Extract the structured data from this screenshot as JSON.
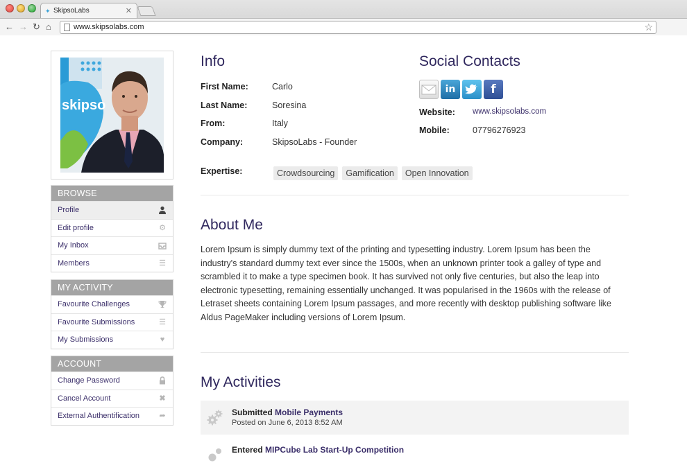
{
  "browser": {
    "tab_title": "SkipsoLabs",
    "url": "www.skipsolabs.com"
  },
  "sidebar": {
    "sections": [
      {
        "title": "BROWSE",
        "items": [
          {
            "label": "Profile",
            "icon": "user-icon"
          },
          {
            "label": "Edit profile",
            "icon": "gear-icon"
          },
          {
            "label": "My Inbox",
            "icon": "inbox-icon"
          },
          {
            "label": "Members",
            "icon": "list-icon"
          }
        ]
      },
      {
        "title": "MY ACTIVITY",
        "items": [
          {
            "label": "Favourite Challenges",
            "icon": "trophy-icon"
          },
          {
            "label": "Favourite Submissions",
            "icon": "list-icon"
          },
          {
            "label": "My Submissions",
            "icon": "heart-icon"
          }
        ]
      },
      {
        "title": "ACCOUNT",
        "items": [
          {
            "label": "Change Password",
            "icon": "lock-icon"
          },
          {
            "label": "Cancel Account",
            "icon": "x-icon"
          },
          {
            "label": "External Authentification",
            "icon": "arrow-icon"
          }
        ]
      }
    ]
  },
  "photo": {
    "banner_text": "skipso"
  },
  "info": {
    "heading": "Info",
    "first_name_label": "First Name:",
    "first_name": "Carlo",
    "last_name_label": "Last Name:",
    "last_name": "Soresina",
    "from_label": "From:",
    "from": "Italy",
    "company_label": "Company:",
    "company": "SkipsoLabs - Founder",
    "expertise_label": "Expertise:",
    "expertise": [
      "Crowdsourcing",
      "Gamification",
      "Open Innovation"
    ]
  },
  "social": {
    "heading": "Social Contacts",
    "icons": [
      "email-icon",
      "linkedin-icon",
      "twitter-icon",
      "facebook-icon"
    ],
    "linkedin_text": "in",
    "facebook_text": "f",
    "website_label": "Website:",
    "website": "www.skipsolabs.com",
    "mobile_label": "Mobile:",
    "mobile": "07796276923"
  },
  "about": {
    "heading": "About Me",
    "text": "Lorem Ipsum is simply dummy text of the printing and typesetting industry. Lorem Ipsum has been the industry's standard dummy text ever since the 1500s, when an unknown printer took a galley of type and scrambled it to make a type specimen book. It has survived not only five centuries, but also the leap into electronic typesetting, remaining essentially unchanged. It was popularised in the 1960s with the release of Letraset sheets containing Lorem Ipsum passages, and more recently with desktop publishing software like Aldus PageMaker including versions of Lorem Ipsum."
  },
  "activities": {
    "heading": "My Activities",
    "items": [
      {
        "verb": "Submitted",
        "name": "Mobile Payments",
        "date": "Posted on June 6, 2013 8:52 AM"
      },
      {
        "verb": "Entered",
        "name": "MIPCube Lab Start-Up Competition",
        "date": ""
      }
    ]
  }
}
